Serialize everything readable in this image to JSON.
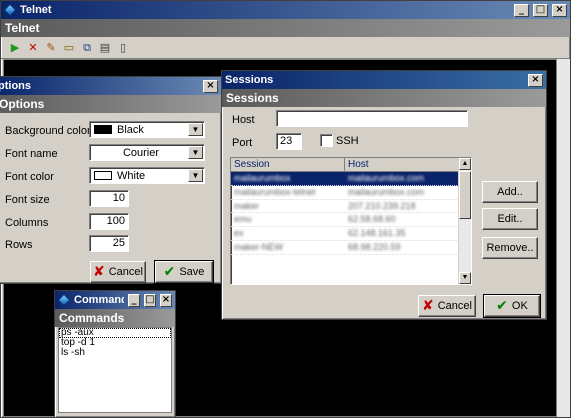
{
  "main": {
    "title": "Telnet",
    "header": "Telnet",
    "toolbar_icons": [
      "play-icon",
      "stop-icon",
      "edit-icon",
      "folder-icon",
      "copy-icon",
      "paste-icon",
      "settings-icon"
    ]
  },
  "options": {
    "title": "ptions",
    "header": "Options",
    "labels": {
      "background_color": "Background color",
      "font_name": "Font name",
      "font_color": "Font color",
      "font_size": "Font size",
      "columns": "Columns",
      "rows": "Rows"
    },
    "values": {
      "background_color": "Black",
      "font_name": "Courier",
      "font_color": "White",
      "font_size": "10",
      "columns": "100",
      "rows": "25"
    },
    "colors": {
      "background_swatch": "#000000",
      "font_swatch": "#ffffff"
    },
    "cancel_label": "Cancel",
    "save_label": "Save"
  },
  "sessions": {
    "title": "Sessions",
    "header": "Sessions",
    "host_label": "Host",
    "host_value": "",
    "port_label": "Port",
    "port_value": "23",
    "ssh_label": "SSH",
    "columns": [
      "Session",
      "Host"
    ],
    "rows": [
      [
        "mailaurumbox",
        "mailaurumbox.com"
      ],
      [
        "mailaurumbox-telnet",
        "mailaurumbox.com"
      ],
      [
        "maker",
        "207.210.239.218"
      ],
      [
        "emu",
        "62.58.68.60"
      ],
      [
        "ex",
        "62.148.161.35"
      ],
      [
        "maker-NEW",
        "68.98.220.59"
      ]
    ],
    "add_label": "Add..",
    "edit_label": "Edit..",
    "remove_label": "Remove..",
    "cancel_label": "Cancel",
    "ok_label": "OK"
  },
  "commands": {
    "title": "Commands",
    "header": "Commands",
    "items": [
      "ps -aux",
      "top -d 1",
      "ls -sh"
    ]
  }
}
